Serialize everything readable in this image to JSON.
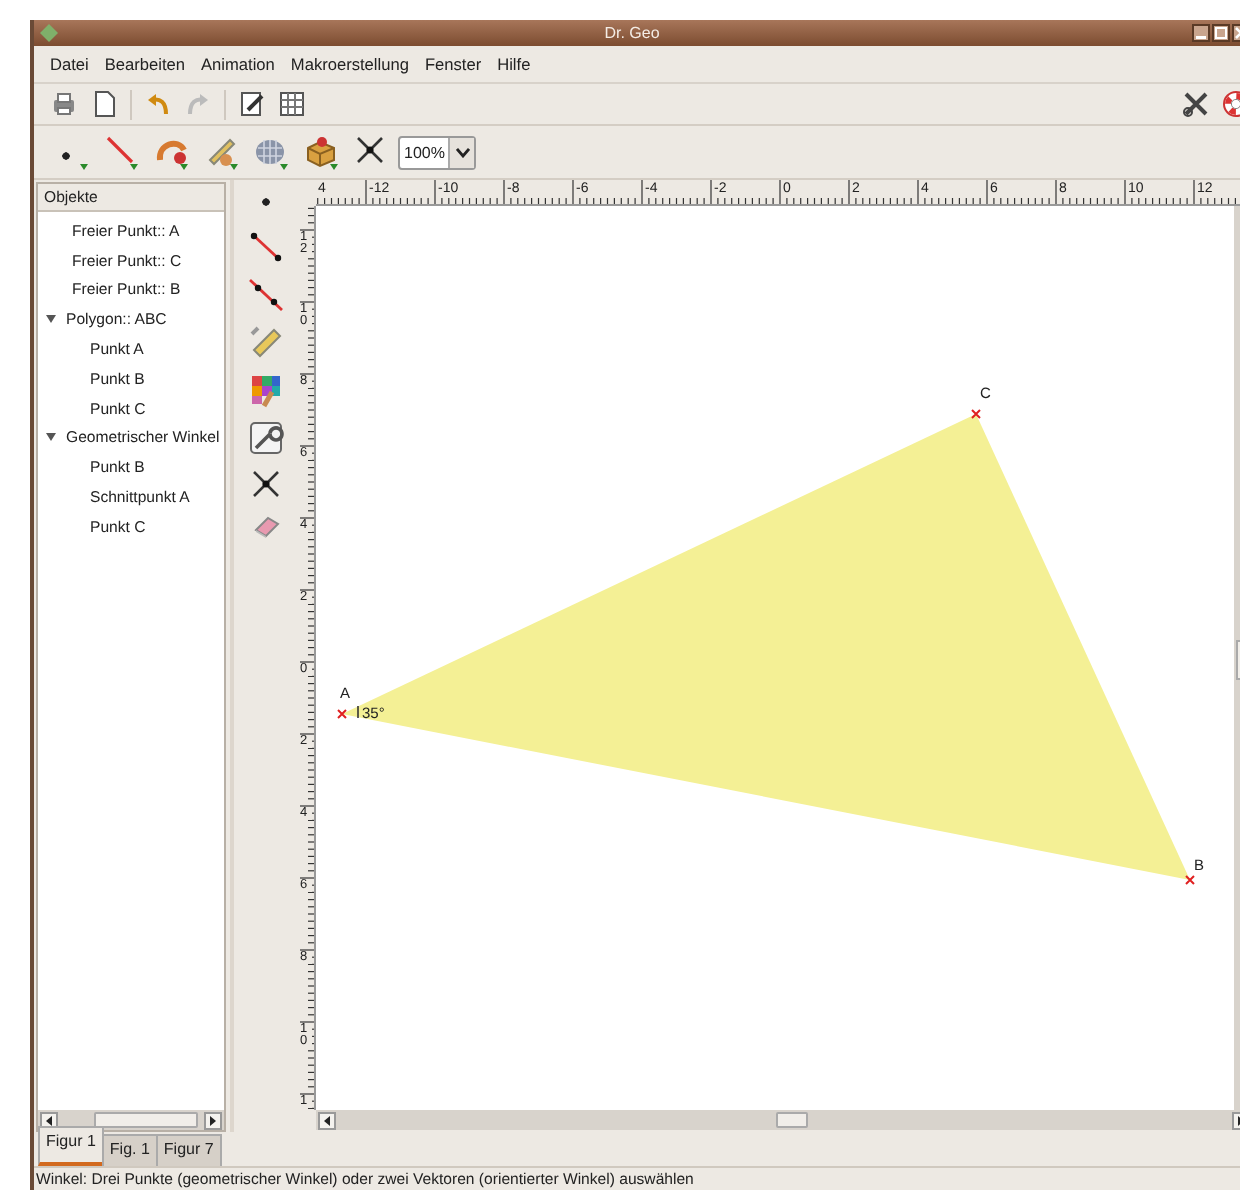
{
  "window": {
    "title": "Dr. Geo"
  },
  "menu": [
    {
      "label": "Datei"
    },
    {
      "label": "Bearbeiten"
    },
    {
      "label": "Animation"
    },
    {
      "label": "Makroerstellung"
    },
    {
      "label": "Fenster"
    },
    {
      "label": "Hilfe"
    }
  ],
  "main_toolbar": [
    {
      "disabled": false
    },
    {
      "disabled": false
    },
    {
      "disabled": false
    },
    {
      "disabled": true
    },
    {
      "disabled": false
    },
    {
      "disabled": false
    }
  ],
  "zoom": {
    "value": "100%"
  },
  "objects_panel": {
    "header": "Objekte",
    "items": [
      {
        "label": "Freier Punkt:: A"
      },
      {
        "label": "Freier Punkt:: C"
      },
      {
        "label": "Freier Punkt:: B"
      },
      {
        "label": "Polygon:: ABC",
        "expanded": true,
        "children": [
          {
            "label": "Punkt A"
          },
          {
            "label": "Punkt B"
          },
          {
            "label": "Punkt C"
          }
        ]
      },
      {
        "label": "Geometrischer Winkel",
        "expanded": true,
        "children": [
          {
            "label": "Punkt B"
          },
          {
            "label": "Schnittpunkt A"
          },
          {
            "label": "Punkt C"
          }
        ]
      }
    ]
  },
  "rulers": {
    "horizontal": [
      "4",
      "-12",
      "-10",
      "-8",
      "-6",
      "-4",
      "-2",
      "0",
      "2",
      "4",
      "6",
      "8",
      "10",
      "12"
    ],
    "vertical": [
      "12",
      "10",
      "8",
      "6",
      "4",
      "2",
      "0",
      "2",
      "4",
      "6",
      "8",
      "10",
      "1"
    ]
  },
  "figure": {
    "points": [
      {
        "label": "A"
      },
      {
        "label": "C"
      },
      {
        "label": "B"
      }
    ],
    "angle_label": "35°"
  },
  "tabs": [
    {
      "label": "Figur 1",
      "selected": true
    },
    {
      "label": "Fig. 1",
      "selected": false
    },
    {
      "label": "Figur 7",
      "selected": false
    }
  ],
  "status_bar": "Winkel: Drei Punkte (geometrischer Winkel) oder zwei Vektoren (orientierter Winkel) auswählen"
}
